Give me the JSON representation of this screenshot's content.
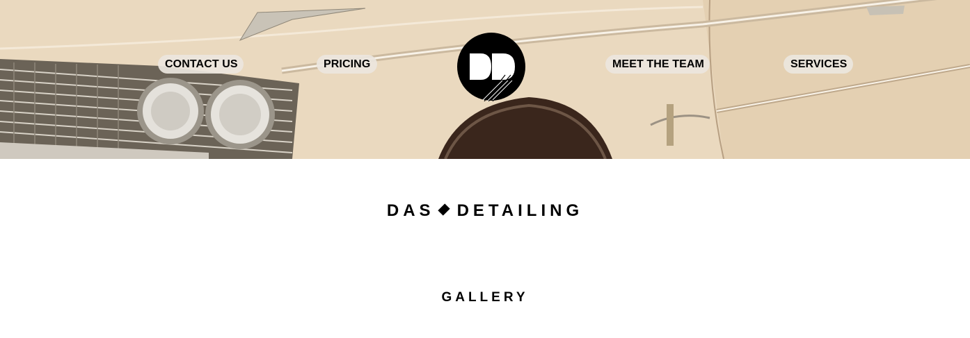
{
  "header": {
    "nav": {
      "contact": "CONTACT US",
      "pricing": "PRICING",
      "team": "MEET THE TEAM",
      "services": "SERVICES"
    },
    "logo": {
      "text": "DD",
      "icon": "dd-logo-icon"
    }
  },
  "brand": {
    "left": "DAS",
    "right": "DETAILING",
    "separator_icon": "diamond-icon"
  },
  "main": {
    "section_title": "GALLERY"
  },
  "colors": {
    "accent": "#000000",
    "pill_bg": "#ece6de",
    "hero_tone": "#e9d7bd"
  }
}
